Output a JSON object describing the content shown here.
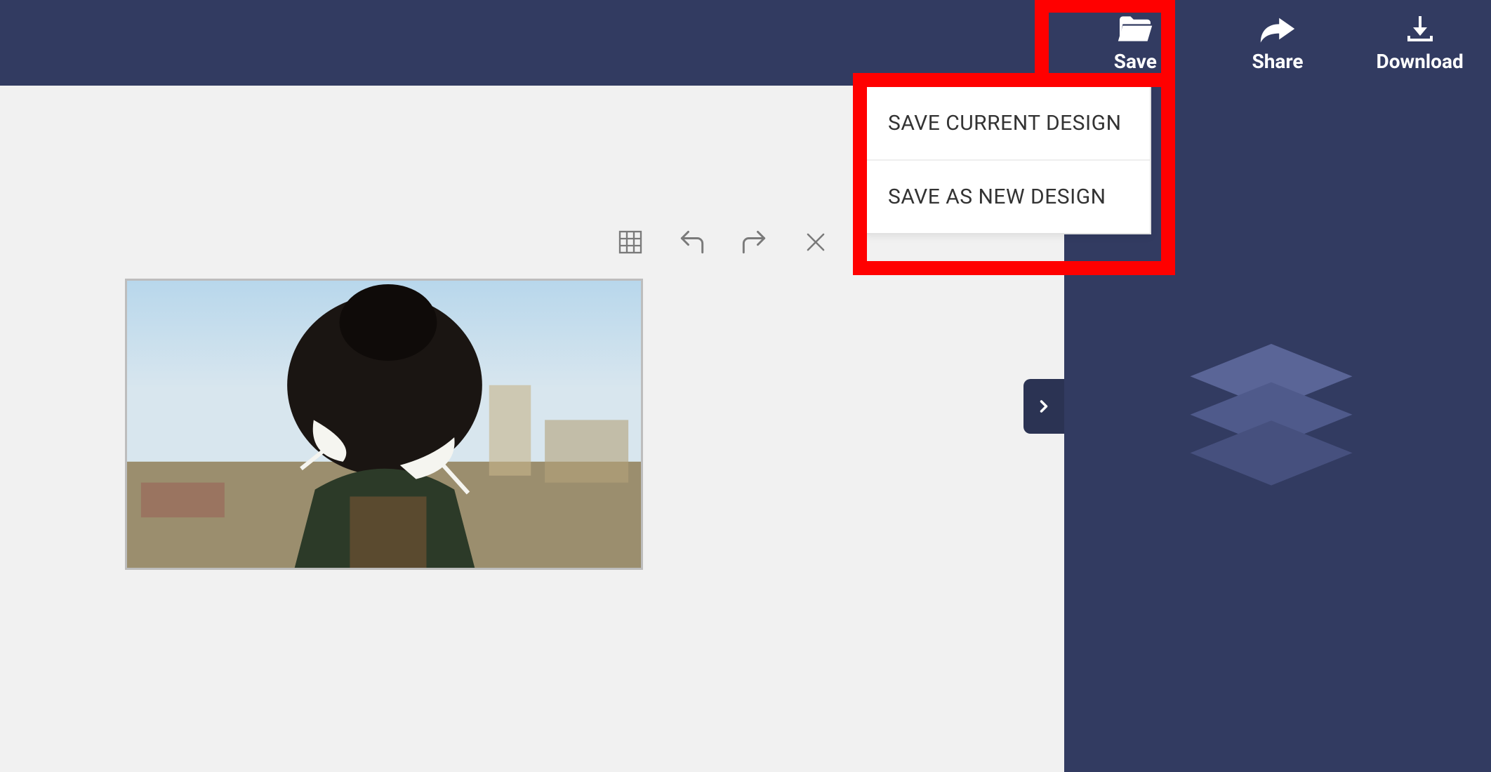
{
  "topbar": {
    "save_label": "Save",
    "share_label": "Share",
    "download_label": "Download"
  },
  "save_menu": {
    "items": [
      "SAVE CURRENT DESIGN",
      "SAVE AS NEW DESIGN"
    ]
  },
  "canvas": {
    "image_alt": "Back view of a person with a bun hairstyle wearing a white mask and green backpack looking over a blurred cityscape"
  }
}
